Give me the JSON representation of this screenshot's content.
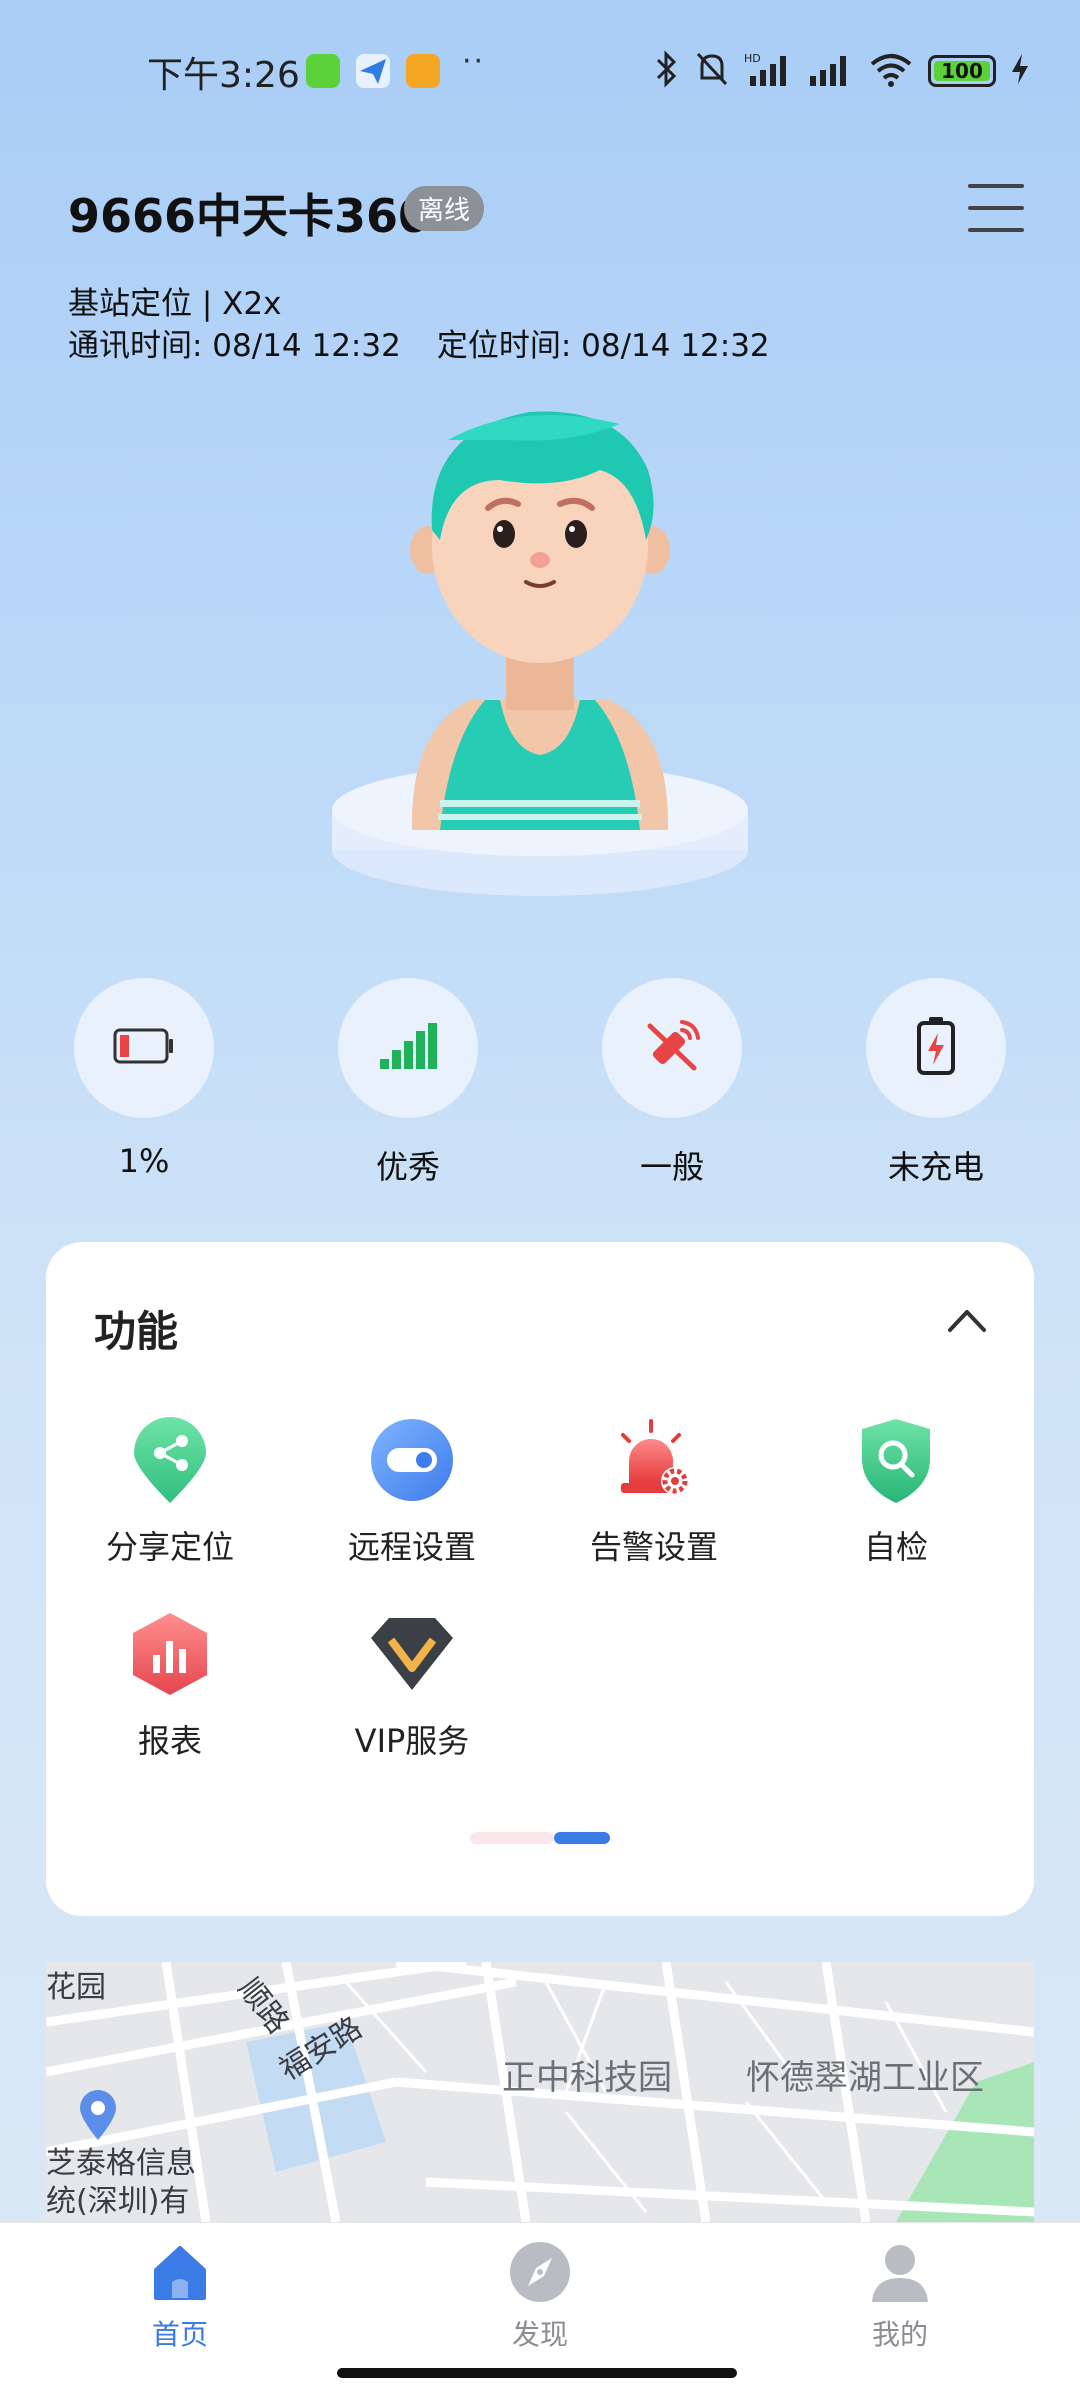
{
  "status_bar": {
    "time": "下午3:26",
    "battery_level": "100",
    "icons": [
      "bluetooth-icon",
      "mute-bell-icon",
      "hd-signal-icon",
      "signal-icon",
      "wifi-icon",
      "battery-icon",
      "charging-icon"
    ],
    "notification_icons": [
      "green-app-icon",
      "blue-plane-app-icon",
      "orange-note-app-icon"
    ],
    "more": "··"
  },
  "header": {
    "device_name": "9666中天卡360",
    "status": "离线",
    "location_type": "基站定位 | X2x",
    "comm_time": "通讯时间: 08/14 12:32",
    "locate_time": "定位时间: 08/14 12:32"
  },
  "stats": [
    {
      "label": "1%",
      "icon": "battery-low-icon"
    },
    {
      "label": "优秀",
      "icon": "signal-bars-icon"
    },
    {
      "label": "一般",
      "icon": "gps-off-icon"
    },
    {
      "label": "未充电",
      "icon": "not-charging-icon"
    }
  ],
  "functions": {
    "title": "功能",
    "items": [
      {
        "label": "分享定位",
        "icon": "share-location-icon"
      },
      {
        "label": "远程设置",
        "icon": "toggle-icon"
      },
      {
        "label": "告警设置",
        "icon": "alarm-settings-icon"
      },
      {
        "label": "自检",
        "icon": "shield-search-icon"
      },
      {
        "label": "报表",
        "icon": "report-chart-icon"
      },
      {
        "label": "VIP服务",
        "icon": "vip-diamond-icon"
      }
    ],
    "page_index": 2,
    "page_count": 2
  },
  "map": {
    "labels": [
      "花园",
      "顺路",
      "福安路",
      "正中科技园",
      "怀德翠湖工业区",
      "芝泰格信息",
      "统(深圳)有"
    ]
  },
  "bottom_nav": [
    {
      "label": "首页",
      "icon": "home-icon",
      "active": true
    },
    {
      "label": "发现",
      "icon": "compass-icon",
      "active": false
    },
    {
      "label": "我的",
      "icon": "profile-icon",
      "active": false
    }
  ],
  "colors": {
    "accent": "#3b7be6",
    "badge_gray": "#8c9097",
    "battery_red": "#e84444",
    "signal_green": "#1fb25a"
  }
}
